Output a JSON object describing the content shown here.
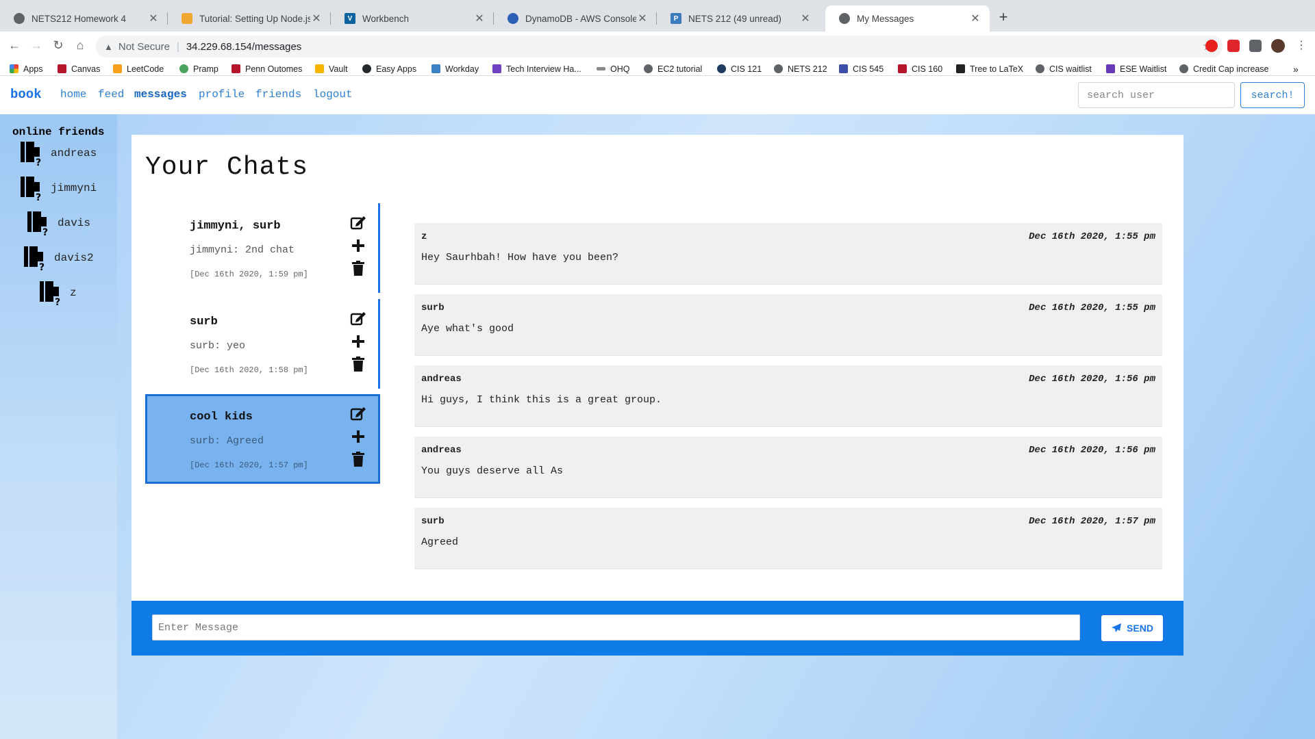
{
  "browser": {
    "tabs": [
      {
        "title": "NETS212 Homework 4",
        "favicon": "globe-icon"
      },
      {
        "title": "Tutorial: Setting Up Node.js on",
        "favicon": "aws-box-icon"
      },
      {
        "title": "Workbench",
        "favicon": "v-icon"
      },
      {
        "title": "DynamoDB - AWS Console",
        "favicon": "dynamodb-icon"
      },
      {
        "title": "NETS 212 (49 unread)",
        "favicon": "piazza-icon"
      },
      {
        "title": "My Messages",
        "favicon": "globe-icon",
        "active": true
      }
    ],
    "new_tab": "+",
    "security_label": "Not Secure",
    "url": "34.229.68.154/messages",
    "bookmarks": [
      "Apps",
      "Canvas",
      "LeetCode",
      "Pramp",
      "Penn Outomes",
      "Vault",
      "Easy Apps",
      "Workday",
      "Tech Interview Ha...",
      "OHQ",
      "EC2 tutorial",
      "CIS 121",
      "NETS 212",
      "CIS 545",
      "CIS 160",
      "Tree to LaTeX",
      "CIS waitlist",
      "ESE Waitlist",
      "Credit Cap increase"
    ],
    "more": "»"
  },
  "nav": {
    "brand": "book",
    "links": [
      "home",
      "feed",
      "messages",
      "profile",
      "friends",
      "logout"
    ],
    "active": "messages",
    "search_placeholder": "search user",
    "search_button": "search!"
  },
  "sidebar": {
    "title": "online friends",
    "friends": [
      "andreas",
      "jimmyni",
      "davis",
      "davis2",
      "z"
    ]
  },
  "page_title": "Your Chats",
  "chats": [
    {
      "name": "jimmyni, surb",
      "last": "jimmyni: 2nd chat",
      "time": "[Dec 16th 2020, 1:59 pm]"
    },
    {
      "name": "surb",
      "last": "surb: yeo",
      "time": "[Dec 16th 2020, 1:58 pm]"
    },
    {
      "name": "cool kids",
      "last": "surb: Agreed",
      "time": "[Dec 16th 2020, 1:57 pm]",
      "selected": true
    }
  ],
  "messages": [
    {
      "sender": "z",
      "time": "Dec 16th 2020, 1:55 pm",
      "text": "Hey Saurhbah! How have you been?"
    },
    {
      "sender": "surb",
      "time": "Dec 16th 2020, 1:55 pm",
      "text": "Aye what's good"
    },
    {
      "sender": "andreas",
      "time": "Dec 16th 2020, 1:56 pm",
      "text": "Hi guys, I think this is a great group."
    },
    {
      "sender": "andreas",
      "time": "Dec 16th 2020, 1:56 pm",
      "text": "You guys deserve all As"
    },
    {
      "sender": "surb",
      "time": "Dec 16th 2020, 1:57 pm",
      "text": "Agreed"
    }
  ],
  "composer": {
    "placeholder": "Enter Message",
    "send_label": "SEND"
  },
  "colors": {
    "accent": "#1a73e8",
    "composer_bg": "#0e7be6",
    "selected_chat": "#78b3ef"
  }
}
